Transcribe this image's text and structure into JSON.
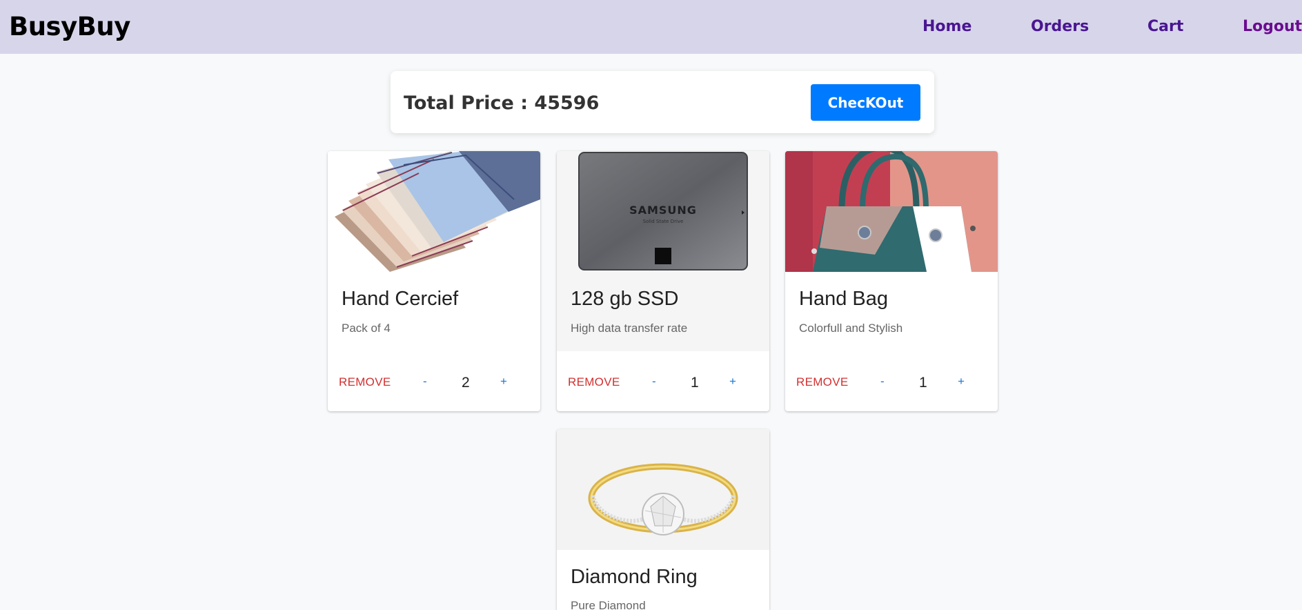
{
  "header": {
    "brand": "BusyBuy",
    "nav": {
      "home": "Home",
      "orders": "Orders",
      "cart": "Cart",
      "logout": "Logout"
    }
  },
  "summary": {
    "total_text": "Total Price : 45596",
    "checkout_label": "ChecKOut"
  },
  "cart": {
    "remove_label": "REMOVE",
    "minus_label": "-",
    "plus_label": "+",
    "items": [
      {
        "title": "Hand Cercief",
        "description": "Pack of 4",
        "quantity": "2",
        "image": "handkerchief-stack"
      },
      {
        "title": "128 gb SSD",
        "description": "High data transfer rate",
        "quantity": "1",
        "image": "samsung-ssd",
        "image_text": "SAMSUNG",
        "image_subtext": "Solid State Drive"
      },
      {
        "title": "Hand Bag",
        "description": "Colorfull and Stylish",
        "quantity": "1",
        "image": "teal-handbag"
      },
      {
        "title": "Diamond Ring",
        "description": "Pure Diamond",
        "image": "gold-diamond-ring"
      }
    ]
  },
  "colors": {
    "navbar": "#d7d5ea",
    "nav_link": "#4a1591",
    "checkout": "#007bff",
    "remove": "#d32f2f",
    "qty_control": "#1976d2"
  }
}
